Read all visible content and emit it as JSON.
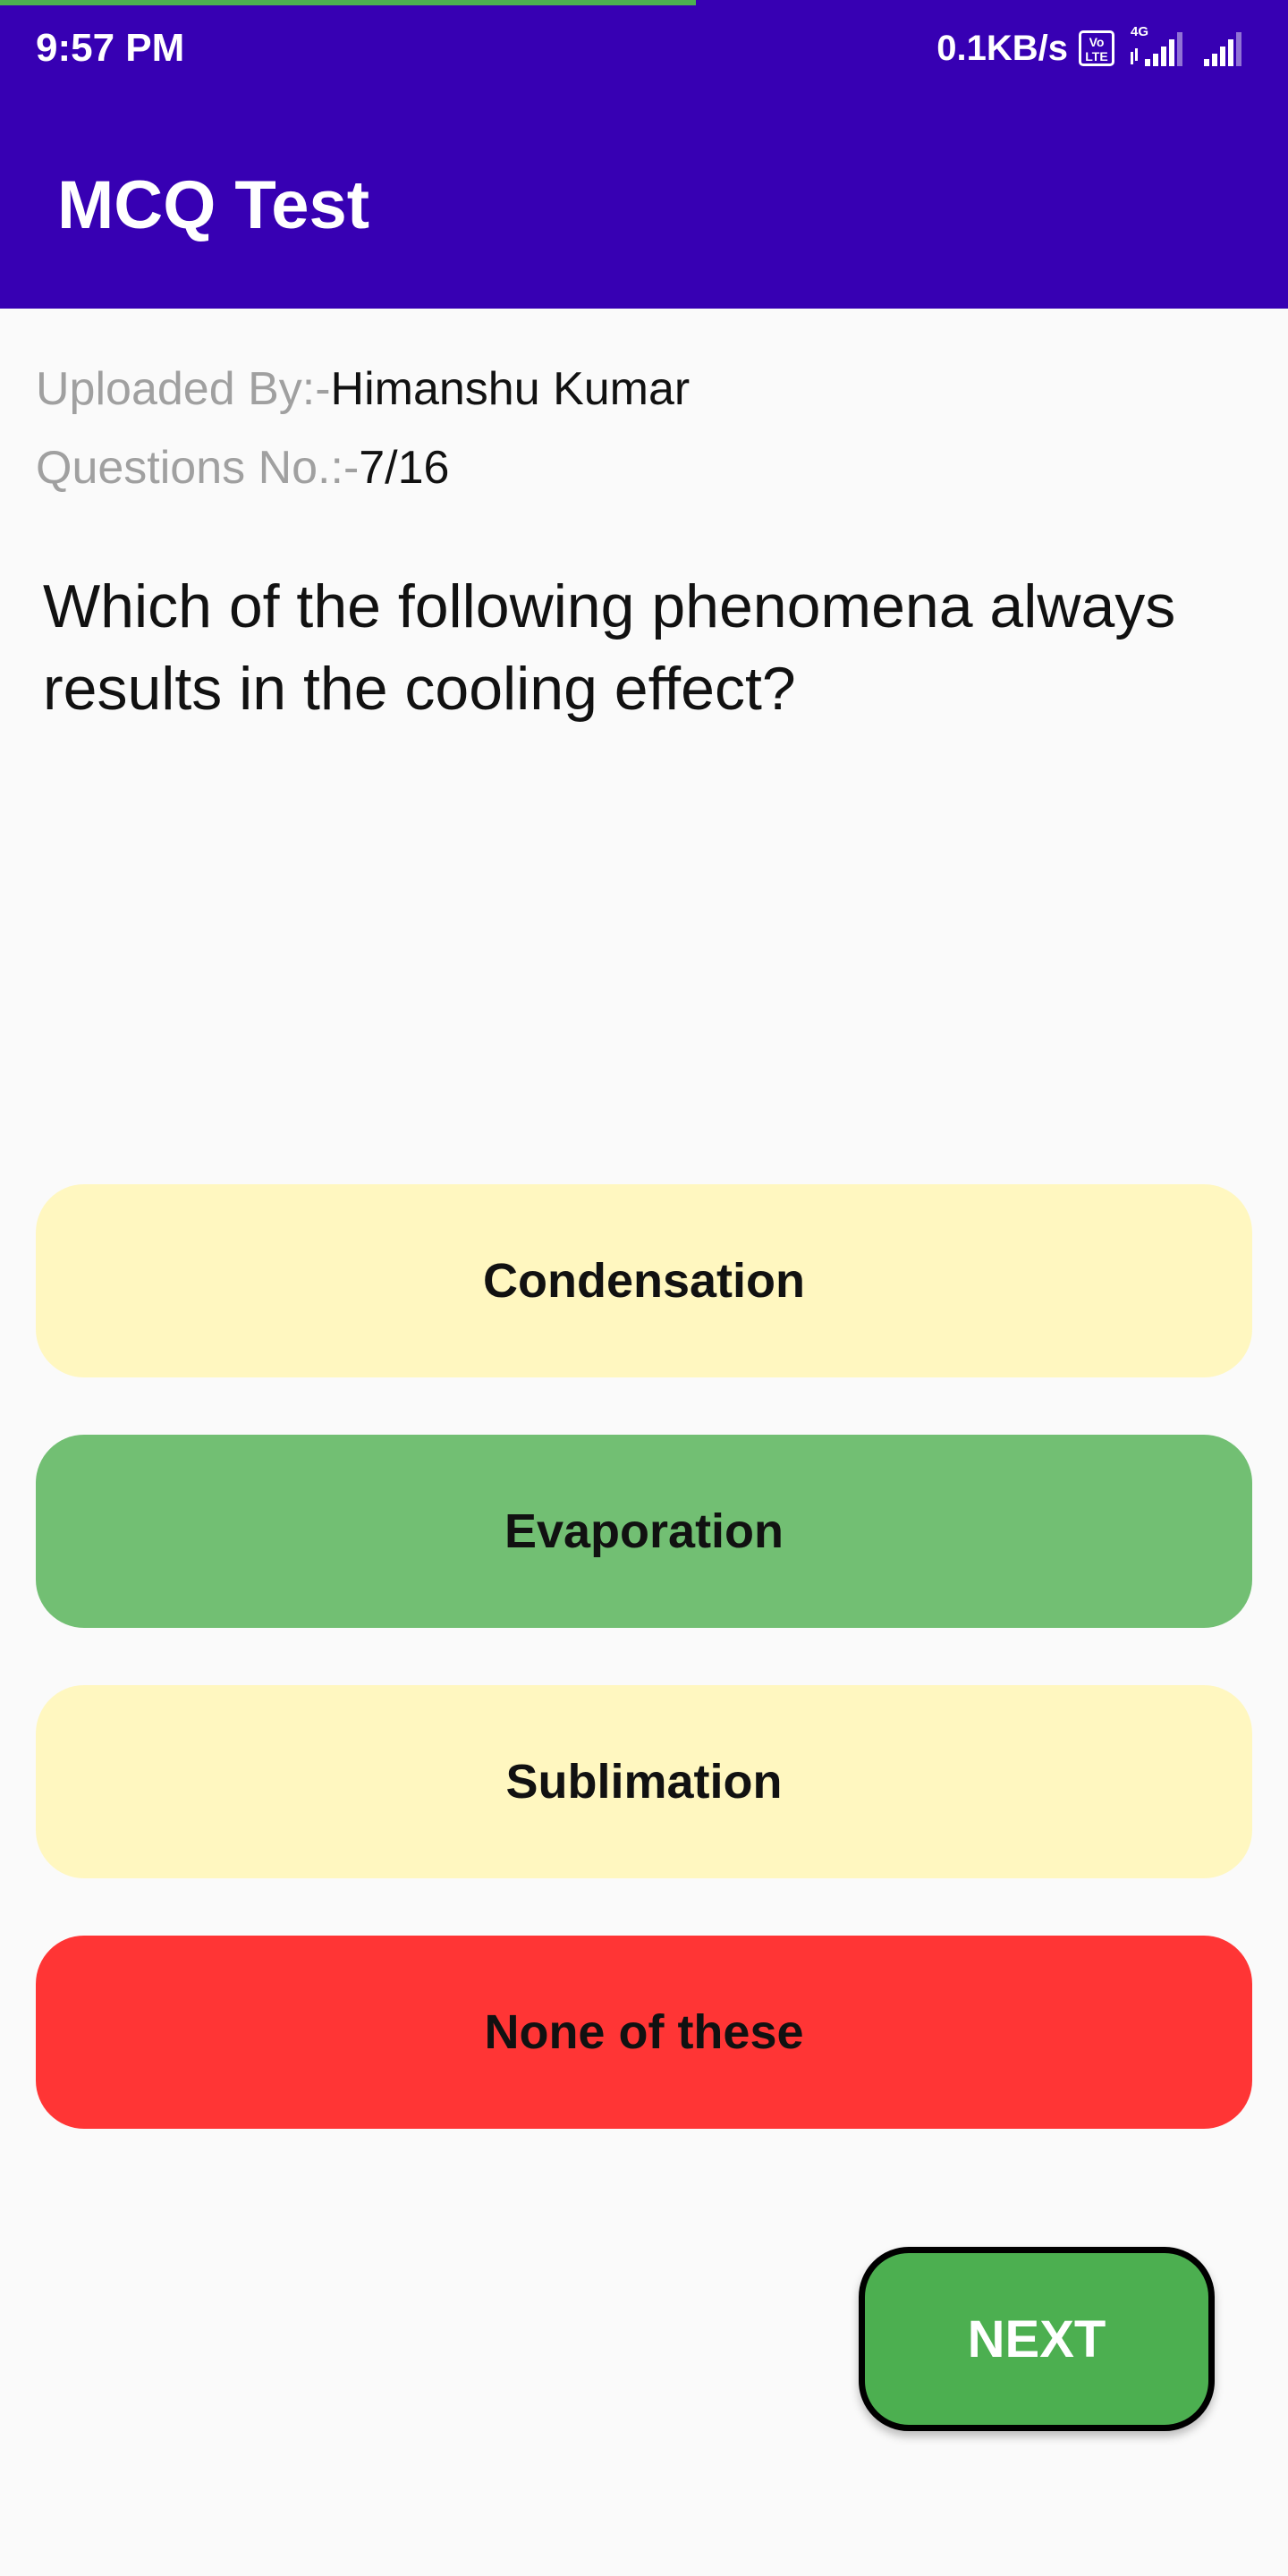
{
  "status_bar": {
    "time": "9:57 PM",
    "net_speed": "0.1KB/s",
    "volte_top": "Vo",
    "volte_bottom": "LTE",
    "network_type": "4G"
  },
  "page_load_progress": 0.54,
  "app_bar": {
    "title": "MCQ Test",
    "background_color": "#3700b3"
  },
  "info": {
    "uploaded_by_label": "Uploaded By:-",
    "uploaded_by_value": "Himanshu Kumar",
    "question_no_label": "Questions No.:-",
    "question_no_value": "7/16"
  },
  "question": {
    "text": "Which of the following phenomena always results in the cooling effect?"
  },
  "options": [
    {
      "label": "Condensation",
      "state": "default",
      "color": "#fff7c0"
    },
    {
      "label": "Evaporation",
      "state": "correct",
      "color": "#72bf73"
    },
    {
      "label": "Sublimation",
      "state": "default",
      "color": "#fff7c0"
    },
    {
      "label": "None of these",
      "state": "wrong",
      "color": "#ff3535"
    }
  ],
  "next_button": {
    "label": "NEXT",
    "color": "#4caf50"
  }
}
